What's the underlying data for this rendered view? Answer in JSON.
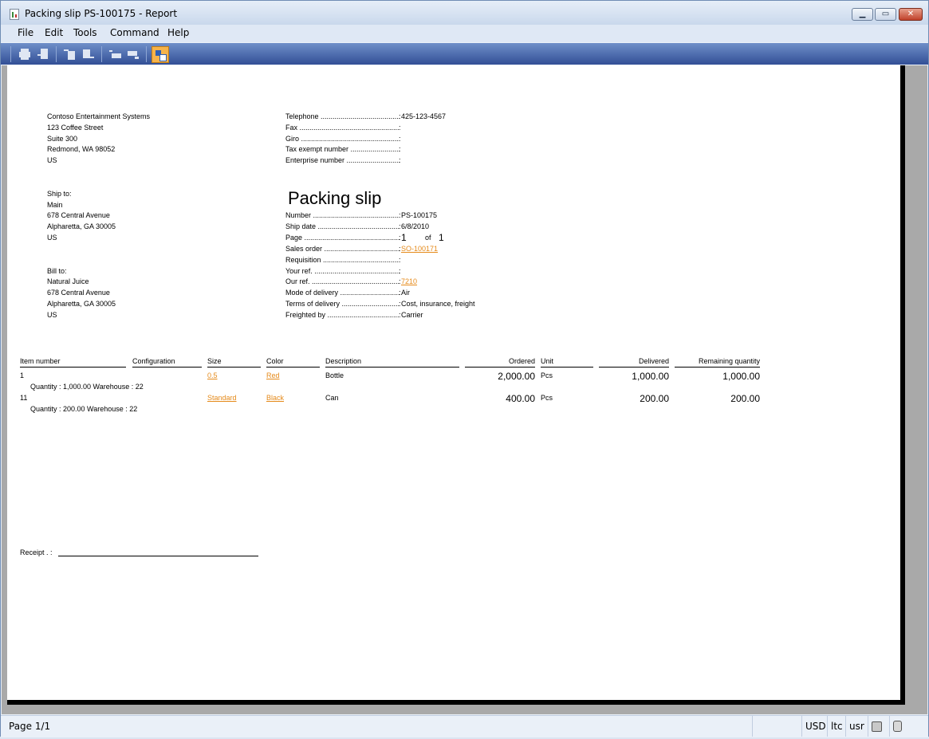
{
  "window": {
    "title": "Packing slip PS-100175 - Report"
  },
  "menu": [
    "File",
    "Edit",
    "Tools",
    "Command",
    "Help"
  ],
  "toolbar": {
    "icons": [
      "print-icon",
      "print-to-icon",
      "first-page-icon",
      "previous-page-icon",
      "next-page-icon",
      "last-page-icon",
      "layout-icon"
    ]
  },
  "company": {
    "name": "Contoso Entertainment Systems",
    "line1": "123 Coffee Street",
    "line2": "Suite 300",
    "line3": "Redmond, WA 98052",
    "line4": "US"
  },
  "contact": {
    "telephone_label": "Telephone",
    "telephone": "425-123-4567",
    "fax_label": "Fax",
    "giro_label": "Giro",
    "tax_label": "Tax exempt number",
    "enterprise_label": "Enterprise number"
  },
  "ship_to": {
    "label": "Ship to:",
    "name": "Main",
    "street": "678 Central Avenue",
    "city": "Alpharetta, GA 30005",
    "country": "US"
  },
  "bill_to": {
    "label": "Bill to:",
    "name": "Natural Juice",
    "street": "678 Central Avenue",
    "city": "Alpharetta, GA 30005",
    "country": "US"
  },
  "doc": {
    "title": "Packing slip",
    "number_label": "Number",
    "number": "PS-100175",
    "ship_date_label": "Ship date",
    "ship_date": "6/8/2010",
    "page_label": "Page",
    "page": "1",
    "of_label": "of",
    "page_total": "1",
    "sales_order_label": "Sales order",
    "sales_order": "SO-100171",
    "requisition_label": "Requisition",
    "your_ref_label": "Your ref.",
    "our_ref_label": "Our ref.",
    "our_ref": "7210",
    "mode_label": "Mode of delivery",
    "mode": "Air",
    "terms_label": "Terms of delivery",
    "terms": "Cost, insurance, freight",
    "freighted_label": "Freighted by",
    "freighted": "Carrier"
  },
  "table": {
    "headers": {
      "item": "Item number",
      "config": "Configuration",
      "size": "Size",
      "color": "Color",
      "desc": "Description",
      "ordered": "Ordered",
      "unit": "Unit",
      "delivered": "Delivered",
      "remaining": "Remaining quantity"
    },
    "rows": [
      {
        "item": "1",
        "size": "0.5",
        "color": "Red",
        "desc": "Bottle",
        "ordered": "2,000.00",
        "unit": "Pcs",
        "delivered": "1,000.00",
        "remaining": "1,000.00",
        "detail": "Quantity : 1,000.00  Warehouse : 22"
      },
      {
        "item": "11",
        "size": "Standard",
        "color": "Black",
        "desc": "Can",
        "ordered": "400.00",
        "unit": "Pcs",
        "delivered": "200.00",
        "remaining": "200.00",
        "detail": "Quantity : 200.00  Warehouse : 22"
      }
    ]
  },
  "receipt_label": "Receipt  . :",
  "status": {
    "page": "Page 1/1",
    "currency": "USD",
    "company": "ltc",
    "user": "usr"
  }
}
